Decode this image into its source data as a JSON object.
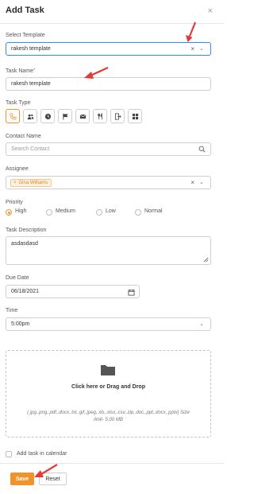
{
  "header": {
    "title": "Add Task",
    "close_glyph": "×"
  },
  "template": {
    "label": "Select Template",
    "value": "rakesh template"
  },
  "task_name": {
    "label": "Task Name",
    "required_mark": "*",
    "value": "rakesh template"
  },
  "task_type": {
    "label": "Task Type",
    "types": [
      {
        "name": "call",
        "icon": "phone-icon",
        "selected": true
      },
      {
        "name": "meeting",
        "icon": "people-icon",
        "selected": false
      },
      {
        "name": "deadline",
        "icon": "clock-icon",
        "selected": false
      },
      {
        "name": "flag",
        "icon": "flag-icon",
        "selected": false
      },
      {
        "name": "email",
        "icon": "mail-icon",
        "selected": false
      },
      {
        "name": "lunch",
        "icon": "cutlery-icon",
        "selected": false
      },
      {
        "name": "exit",
        "icon": "exit-icon",
        "selected": false
      },
      {
        "name": "other",
        "icon": "grid-icon",
        "selected": false
      }
    ]
  },
  "contact": {
    "label": "Contact Name",
    "placeholder": "Search Contact"
  },
  "assignee": {
    "label": "Assignee",
    "tag": "Gina Williams",
    "tag_remove": "×"
  },
  "priority": {
    "label": "Priority",
    "options": [
      "High",
      "Medium",
      "Low",
      "Normal"
    ],
    "selected": "High"
  },
  "description": {
    "label": "Task Description",
    "value": "asdasdasd"
  },
  "due_date": {
    "label": "Due Date",
    "value": "06/18/2021"
  },
  "time": {
    "label": "Time",
    "value": "5:00pm"
  },
  "upload": {
    "main_text": "Click here or Drag and Drop",
    "hint": "(.jpg,.png,.pdf,.docx,.txt,.gif,.jpeg,.xls,.xlsx,.csv,.zip,.doc,.ppt,.docx,.pptx) Size limit- 5.00 MB"
  },
  "calendar_checkbox": {
    "label": "Add task in calendar",
    "checked": false
  },
  "footer": {
    "save_label": "Save",
    "reset_label": "Reset"
  },
  "colors": {
    "accent": "#f0932b",
    "focus": "#3a86ff",
    "annotation_arrow": "#e53935"
  }
}
